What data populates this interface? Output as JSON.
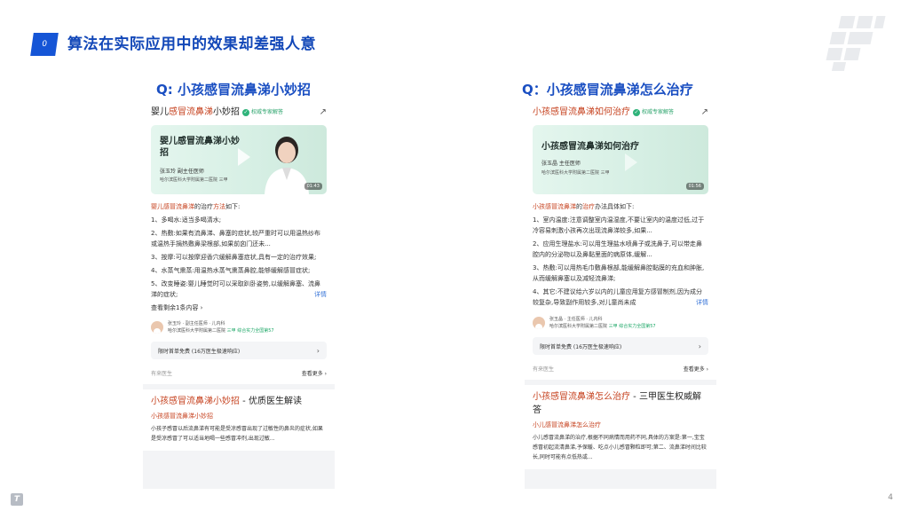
{
  "slide": {
    "number": "0",
    "title": "算法在实际应用中的效果却差强人意",
    "page": "4"
  },
  "left": {
    "question": "Q: 小孩感冒流鼻涕小妙招",
    "card1": {
      "title_a": "婴儿",
      "title_hl": "感冒流鼻涕",
      "title_b": "小妙招",
      "badge": "权威专家解答",
      "video_title": "婴儿感冒流鼻涕小妙招",
      "video_doctor": "张玉玲  副主任医师",
      "video_hospital": "哈尔滨医科大学附属第二医院  三甲",
      "duration": "01:43",
      "intro_hl": "婴儿感冒流鼻涕",
      "intro_a": "的治疗",
      "intro_hl2": "方法",
      "intro_b": "如下:",
      "items": [
        "1、多喝水:适当多喝清水;",
        "2、热敷:如果有流鼻涕、鼻塞的症状,较严重时可以用温热纱布或温热手捐热敷鼻梁根部,如果前囟门还未...",
        "3、按摩:可以按摩迎香穴缓解鼻塞症状,具有一定的治疗效果;",
        "4、水蒸气熏蒸:用温热水蒸气熏蒸鼻腔,能够缓解感冒症状;",
        "5、改变睡姿:婴儿睡觉时可以采取趴卧姿势,以缓解鼻塞、流鼻涕的症状;"
      ],
      "more": "详情",
      "expand": "查看剩余1条内容 ›",
      "doc_line1": "张玉玲 · 副主任医师 · 儿内科",
      "doc_line2": "哈尔滨医科大学附属第二医院",
      "doc_tag1": "三甲",
      "doc_tag2": "综合实力全国第57",
      "free": "限时首单免费 (16万医生极速响应)",
      "free_arrow": "›",
      "foot_left": "有来医生",
      "foot_right": "查看更多 ›"
    },
    "card2": {
      "title_hl": "小孩感冒流鼻涕小妙招",
      "title_b": " - 优质医生解读",
      "sub": "小孩感冒流鼻涕小妙招",
      "body": "小孩子感冒以后流鼻涕有可能是受凉感冒出现了过敏性的鼻炎的症状,如果是受凉感冒了可以适当地喝一些感冒冲剂,出现过敏..."
    }
  },
  "right": {
    "question": "Q：小孩感冒流鼻涕怎么治疗",
    "card1": {
      "title_hl": "小孩感冒流鼻涕",
      "title_b": "如何治疗",
      "badge": "权威专家解答",
      "video_title": "小孩感冒流鼻涕如何治疗",
      "video_doctor": "张玉晶  主任医师",
      "video_hospital": "哈尔滨医科大学附属第二医院  三甲",
      "duration": "01:56",
      "intro_hl": "小孩感冒流鼻涕",
      "intro_a": "的",
      "intro_hl2": "治疗",
      "intro_b": "办法具体如下:",
      "items": [
        "1、室内温度:注意调整室内温湿度,不要让室内的温度过低,过于冷容易刺激小孩再次出现流鼻涕较多,如果...",
        "2、应用生理盐水:可以用生理盐水喷鼻子或洗鼻子,可以带走鼻腔内的分泌物以及鼻黏里面的病原体,缓解...",
        "3、热敷:可以用热毛巾敷鼻根部,能缓解鼻腔黏膜的充血和肿胀,从而缓解鼻塞以及减轻流鼻涕;",
        "4、其它:不建议给六岁以内的儿童应用复方感冒制剂,因为成分较复杂,导致副作用较多,对儿童尚未成"
      ],
      "more": "详情",
      "doc_line1": "张玉晶 · 主任医师 · 儿内科",
      "doc_line2": "哈尔滨医科大学附属第二医院",
      "doc_tag1": "三甲",
      "doc_tag2": "综合实力全国第57",
      "free": "限时首单免费 (16万医生极速响应)",
      "free_arrow": "›",
      "foot_left": "有来医生",
      "foot_right": "查看更多 ›"
    },
    "card2": {
      "title_hl": "小孩感冒流鼻涕怎么治疗",
      "title_b": " - 三甲医生权威解答",
      "sub": "小儿感冒流鼻涕怎么治疗",
      "body": "小儿感冒流鼻涕的治疗,根据不同病情而用药不同,具体的方案是:第一,宝宝感冒初起流清鼻涕,予保暖、吃点小儿感冒颗粒即可;第二、流鼻涕时间比较长,同时可能有点低热或..."
    }
  },
  "colors": {
    "accent": "#1555d6",
    "highlight": "#c6421f",
    "verified": "#2fb37a"
  }
}
